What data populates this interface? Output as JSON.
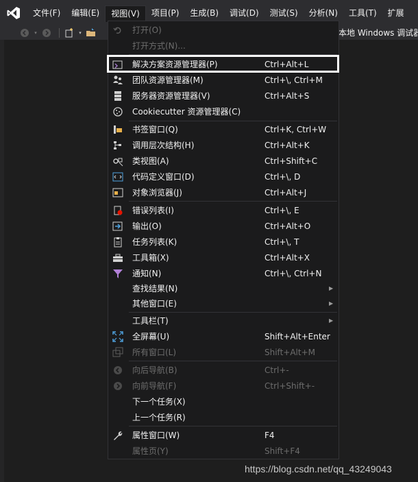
{
  "menubar": {
    "items": [
      "文件(F)",
      "编辑(E)",
      "视图(V)",
      "项目(P)",
      "生成(B)",
      "调试(D)",
      "测试(S)",
      "分析(N)",
      "工具(T)",
      "扩展"
    ]
  },
  "toolbar": {
    "run_target": "本地 Windows 调试器"
  },
  "view_menu": {
    "items": [
      {
        "label": "打开(O)",
        "shortcut": "",
        "disabled": true,
        "icon": "undo-arrow-icon"
      },
      {
        "label": "打开方式(N)...",
        "shortcut": "",
        "disabled": true,
        "icon": ""
      },
      {
        "label": "解决方案资源管理器(P)",
        "shortcut": "Ctrl+Alt+L",
        "disabled": false,
        "icon": "solution-explorer-icon"
      },
      {
        "label": "团队资源管理器(M)",
        "shortcut": "Ctrl+\\, Ctrl+M",
        "disabled": false,
        "icon": "team-explorer-icon"
      },
      {
        "label": "服务器资源管理器(V)",
        "shortcut": "Ctrl+Alt+S",
        "disabled": false,
        "icon": "server-explorer-icon"
      },
      {
        "label": "Cookiecutter 资源管理器(C)",
        "shortcut": "",
        "disabled": false,
        "icon": "cookiecutter-icon"
      },
      {
        "label": "书签窗口(Q)",
        "shortcut": "Ctrl+K, Ctrl+W",
        "disabled": false,
        "icon": "bookmark-icon"
      },
      {
        "label": "调用层次结构(H)",
        "shortcut": "Ctrl+Alt+K",
        "disabled": false,
        "icon": "call-hierarchy-icon"
      },
      {
        "label": "类视图(A)",
        "shortcut": "Ctrl+Shift+C",
        "disabled": false,
        "icon": "class-view-icon"
      },
      {
        "label": "代码定义窗口(D)",
        "shortcut": "Ctrl+\\, D",
        "disabled": false,
        "icon": "code-definition-icon"
      },
      {
        "label": "对象浏览器(J)",
        "shortcut": "Ctrl+Alt+J",
        "disabled": false,
        "icon": "object-browser-icon"
      },
      {
        "label": "错误列表(I)",
        "shortcut": "Ctrl+\\, E",
        "disabled": false,
        "icon": "error-list-icon"
      },
      {
        "label": "输出(O)",
        "shortcut": "Ctrl+Alt+O",
        "disabled": false,
        "icon": "output-icon"
      },
      {
        "label": "任务列表(K)",
        "shortcut": "Ctrl+\\, T",
        "disabled": false,
        "icon": "task-list-icon"
      },
      {
        "label": "工具箱(X)",
        "shortcut": "Ctrl+Alt+X",
        "disabled": false,
        "icon": "toolbox-icon"
      },
      {
        "label": "通知(N)",
        "shortcut": "Ctrl+\\, Ctrl+N",
        "disabled": false,
        "icon": "notification-flag-icon"
      },
      {
        "label": "查找结果(N)",
        "shortcut": "",
        "disabled": false,
        "icon": "",
        "submenu": true
      },
      {
        "label": "其他窗口(E)",
        "shortcut": "",
        "disabled": false,
        "icon": "",
        "submenu": true
      },
      {
        "label": "工具栏(T)",
        "shortcut": "",
        "disabled": false,
        "icon": "",
        "submenu": true
      },
      {
        "label": "全屏幕(U)",
        "shortcut": "Shift+Alt+Enter",
        "disabled": false,
        "icon": "fullscreen-icon"
      },
      {
        "label": "所有窗口(L)",
        "shortcut": "Shift+Alt+M",
        "disabled": true,
        "icon": "all-windows-icon"
      },
      {
        "label": "向后导航(B)",
        "shortcut": "Ctrl+-",
        "disabled": true,
        "icon": "navigate-back-icon"
      },
      {
        "label": "向前导航(F)",
        "shortcut": "Ctrl+Shift+-",
        "disabled": true,
        "icon": "navigate-forward-icon"
      },
      {
        "label": "下一个任务(X)",
        "shortcut": "",
        "disabled": false,
        "icon": ""
      },
      {
        "label": "上一个任务(R)",
        "shortcut": "",
        "disabled": false,
        "icon": ""
      },
      {
        "label": "属性窗口(W)",
        "shortcut": "F4",
        "disabled": false,
        "icon": "wrench-icon"
      },
      {
        "label": "属性页(Y)",
        "shortcut": "Shift+F4",
        "disabled": true,
        "icon": ""
      }
    ]
  },
  "watermark": "https://blog.csdn.net/qq_43249043",
  "colors": {
    "menubar_bg": "#2d2d30",
    "menu_bg": "#1b1b1c",
    "text": "#f1f1f1",
    "disabled_text": "#6d6d6d",
    "vs_purple": "#68217a",
    "highlight_border": "#ffffff"
  }
}
